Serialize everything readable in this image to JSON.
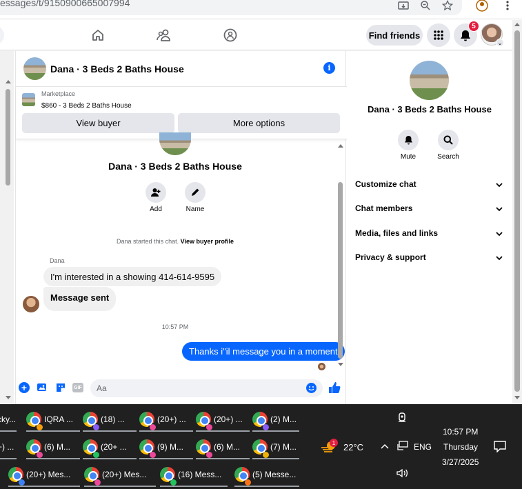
{
  "browser": {
    "url": "essages/t/9150900665007994"
  },
  "topnav": {
    "find_friends_label": "Find friends",
    "notification_count": "5"
  },
  "chat": {
    "title": "Dana · 3 Beds 2 Baths House",
    "marketplace": {
      "label": "Marketplace",
      "listing": "$860 - 3 Beds 2 Baths House",
      "view_buyer_label": "View buyer",
      "more_options_label": "More options"
    },
    "intro": {
      "title": "Dana · 3 Beds 2 Baths House",
      "add_label": "Add",
      "name_label": "Name"
    },
    "system_note": "Dana started this chat.",
    "system_link": "View buyer profile",
    "messages": [
      {
        "sender": "Dana",
        "text": "I'm interested in a showing 414-614-9595"
      },
      {
        "text": "Message sent"
      },
      {
        "timestamp": "10:57 PM"
      },
      {
        "text": "Thanks i\"il message you in a moment"
      }
    ],
    "composer_placeholder": "Aa"
  },
  "details": {
    "title": "Dana · 3 Beds 2 Baths House",
    "mute_label": "Mute",
    "search_label": "Search",
    "sections": [
      "Customize chat",
      "Chat members",
      "Media, files and links",
      "Privacy & support"
    ]
  },
  "taskbar": {
    "row1": [
      "cky...",
      "IQRA ...",
      "(18) ...",
      "(20+) ...",
      "(20+) ...",
      "(2) M..."
    ],
    "row2": [
      "+) ...",
      "(6) M...",
      "(20+ ...",
      "(9) M...",
      "(6) M...",
      "(7) M..."
    ],
    "row3": [
      "(20+) Mes...",
      "(20+) Mes...",
      "(16) Mess...",
      "(5) Messe..."
    ],
    "weather_temp": "22°C",
    "weather_badge": "1",
    "language": "ENG",
    "time": "10:57 PM",
    "day": "Thursday",
    "date": "3/27/2025"
  }
}
